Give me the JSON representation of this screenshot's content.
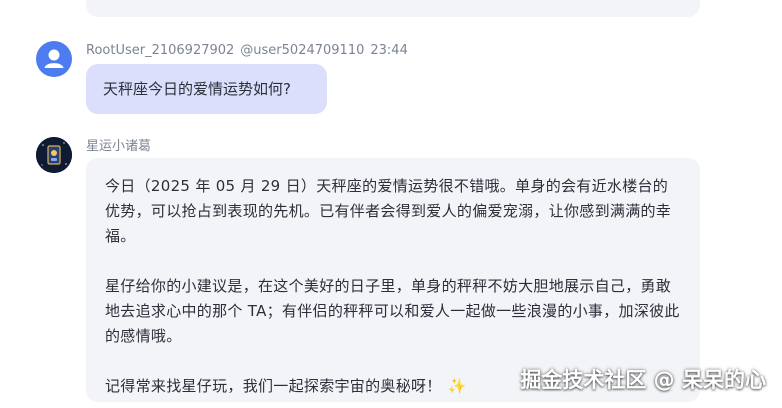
{
  "messages": {
    "user": {
      "name": "RootUser_2106927902",
      "handle": "@user5024709110",
      "time": "23:44",
      "text": "天秤座今日的爱情运势如何?"
    },
    "bot": {
      "name": "星运小诸葛",
      "paragraphs": [
        "今日（2025 年 05 月 29 日）天秤座的爱情运势很不错哦。单身的会有近水楼台的优势，可以抢占到表现的先机。已有伴者会得到爱人的偏爱宠溺，让你感到满满的幸福。",
        "星仔给你的小建议是，在这个美好的日子里，单身的秤秤不妨大胆地展示自己，勇敢地去追求心中的那个 TA；有伴侣的秤秤可以和爱人一起做一些浪漫的小事，加深彼此的感情哦。",
        "记得常来找星仔玩，我们一起探索宇宙的奥秘呀！"
      ],
      "sparkle": "✨"
    }
  },
  "watermark": "掘金技术社区 @ 呆呆的心",
  "icons": {
    "user_avatar": "user-avatar-icon",
    "bot_avatar": "astrology-avatar-icon",
    "sparkle": "sparkle-icon"
  },
  "colors": {
    "user_avatar_bg": "#4d7cf0",
    "user_bubble": "#dcdffc",
    "bot_bubble": "#f3f4f7",
    "meta_text": "#7c8494"
  }
}
